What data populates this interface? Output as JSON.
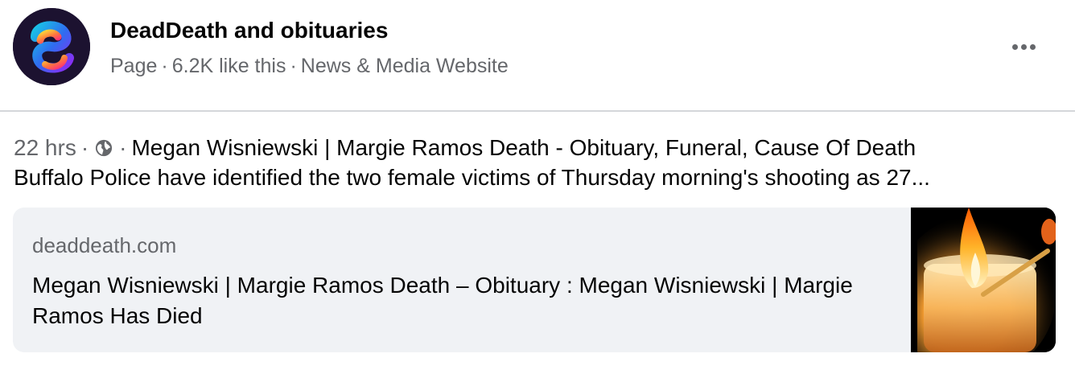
{
  "page": {
    "name": "DeadDeath and obituaries",
    "type": "Page",
    "likes": "6.2K like this",
    "category": "News & Media Website",
    "separator": "·"
  },
  "icons": {
    "avatar": "page-logo-icon",
    "more": "more-options-icon",
    "audience": "globe-icon",
    "thumbnail": "candle-flame-image"
  },
  "post": {
    "time": "22 hrs",
    "separator": "·",
    "title": "Megan Wisniewski | Margie Ramos Death - Obituary, Funeral, Cause Of Death",
    "excerpt": "Buffalo Police have identified the two female victims of Thursday morning's shooting as 27..."
  },
  "link": {
    "domain": "deaddeath.com",
    "title": "Megan Wisniewski | Margie Ramos Death – Obituary : Megan Wisniewski | Margie Ramos Has Died"
  },
  "colors": {
    "text_primary": "#050505",
    "text_secondary": "#65676b",
    "card_background": "#f0f2f5",
    "divider": "#d4d6da"
  }
}
